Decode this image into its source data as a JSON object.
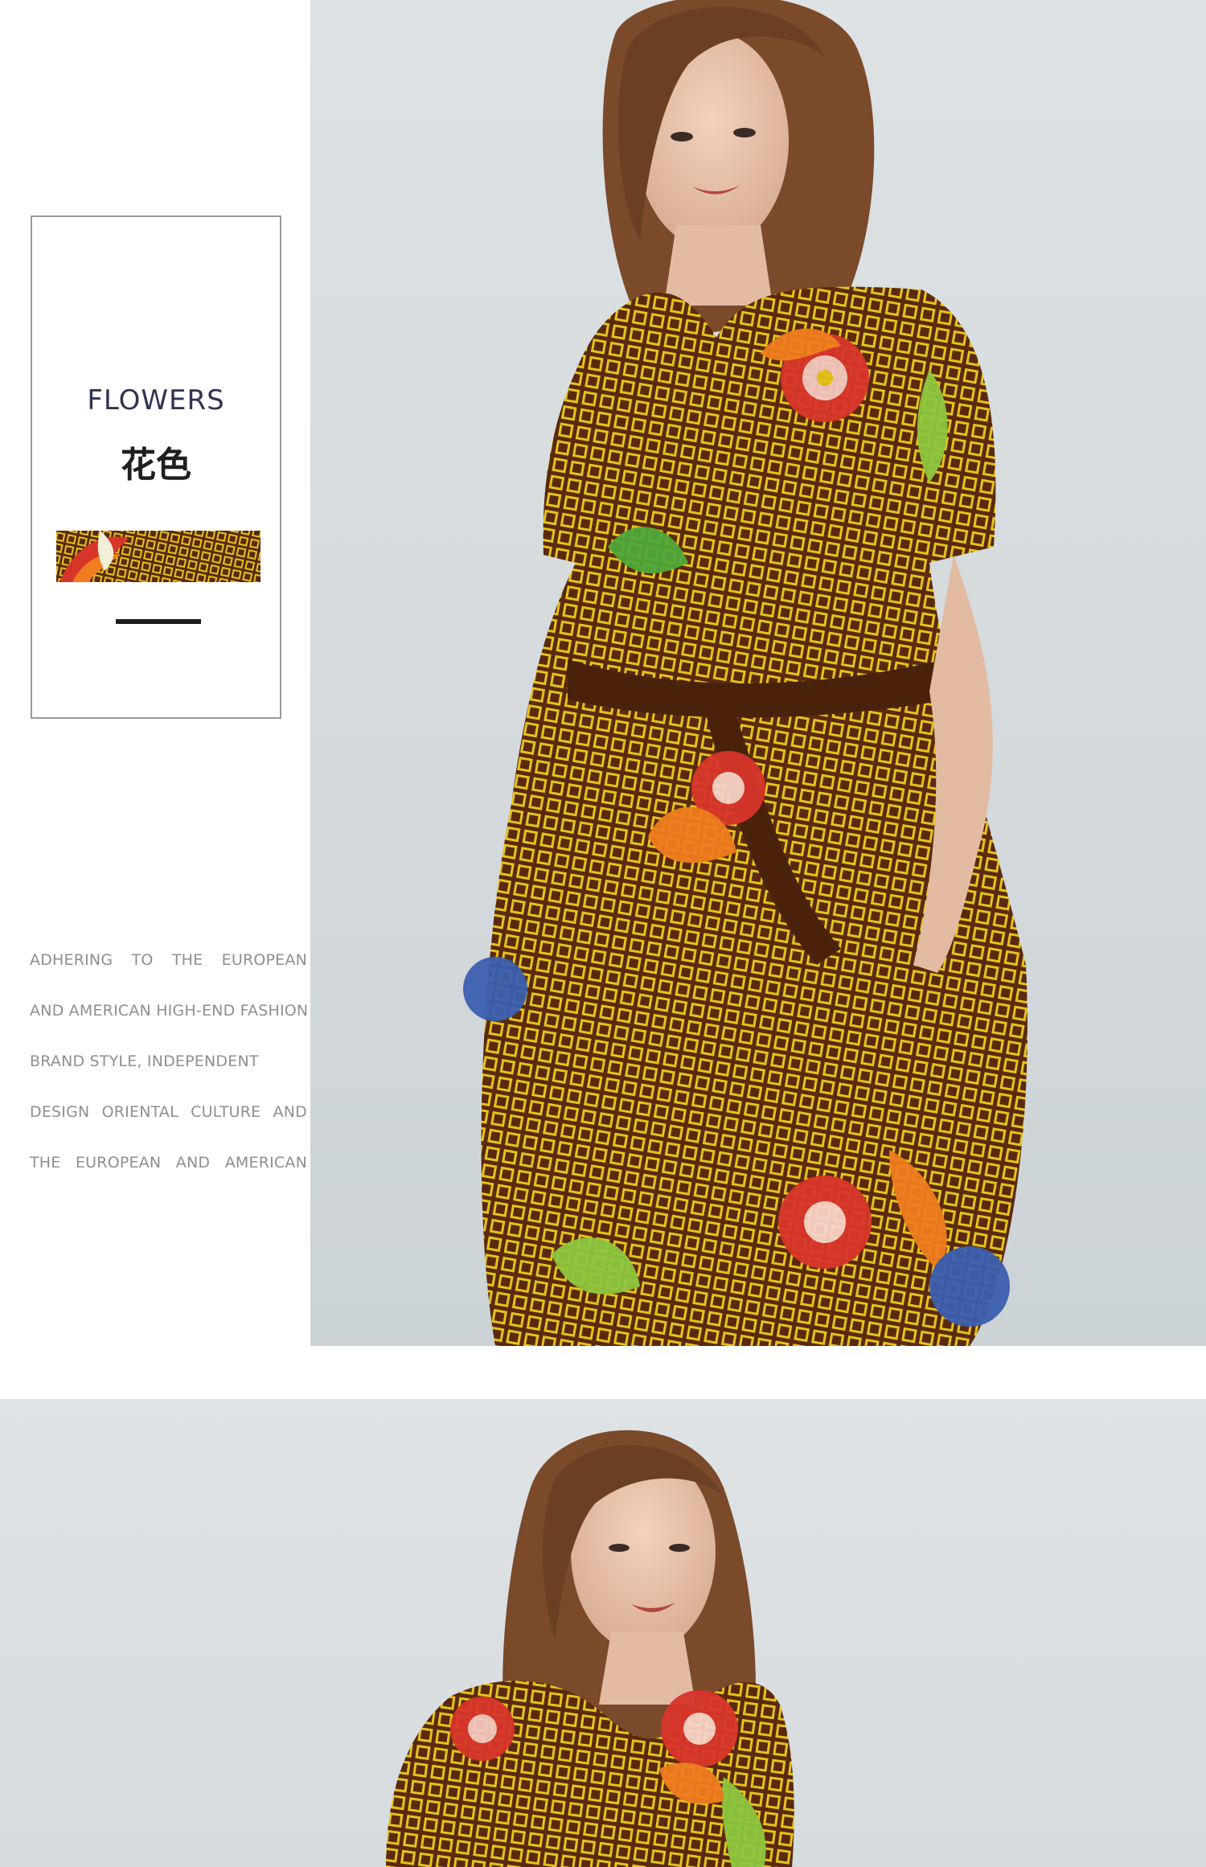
{
  "color_card": {
    "title_en": "FLOWERS",
    "title_cn": "花色",
    "swatch_icon": "floral-diamond-print-swatch",
    "accent_colors": {
      "base": "#5a2a0e",
      "lattice": "#e6c21a",
      "flower_red": "#d8352a",
      "leaf_green": "#4fa83a"
    }
  },
  "brand_copy": {
    "lines": [
      "ADHERING TO THE EUROPEAN",
      "AND AMERICAN HIGH-END FASHION",
      "BRAND STYLE, INDEPENDENT",
      "DESIGN  ORIENTAL CULTURE AND",
      "THE EUROPEAN AND AMERICAN"
    ]
  },
  "photos": [
    {
      "name": "model-photo-front",
      "icon": "model-in-printed-wrap-dress"
    },
    {
      "name": "model-photo-closeup",
      "icon": "model-in-printed-wrap-dress"
    }
  ]
}
